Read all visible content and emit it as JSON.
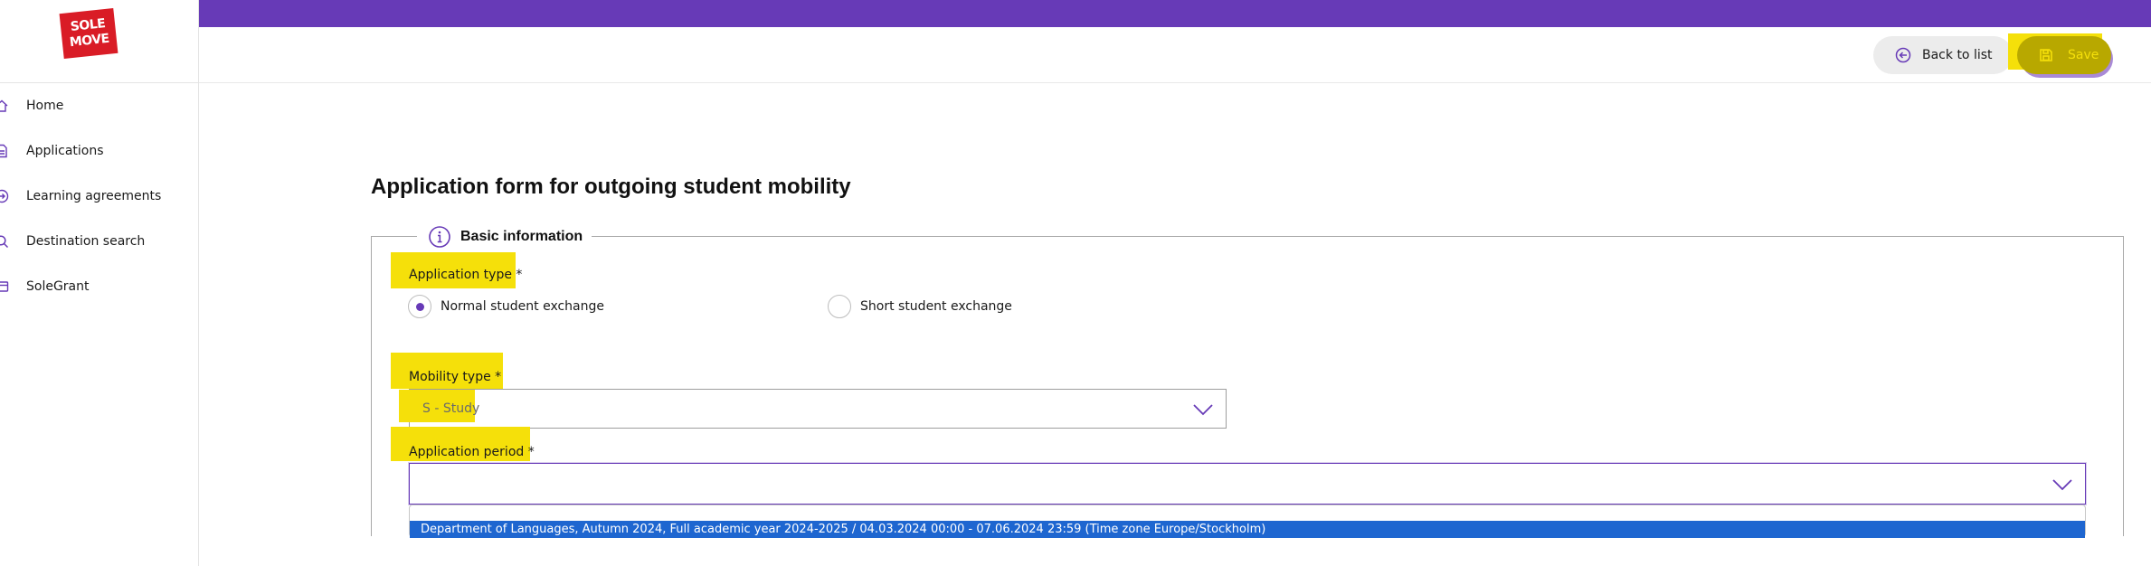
{
  "logo": {
    "text_line1": "SOLE",
    "text_line2": "MOVE"
  },
  "sidebar": {
    "items": [
      {
        "label": "Home",
        "icon": "home-icon"
      },
      {
        "label": "Applications",
        "icon": "document-icon"
      },
      {
        "label": "Learning agreements",
        "icon": "arrow-right-circle-icon"
      },
      {
        "label": "Destination search",
        "icon": "search-icon"
      },
      {
        "label": "SoleGrant",
        "icon": "card-icon"
      }
    ]
  },
  "toolbar": {
    "back_label": "Back to list",
    "save_label": "Save"
  },
  "page": {
    "title": "Application form for outgoing student mobility"
  },
  "basic_info": {
    "legend": "Basic information",
    "application_type": {
      "label": "Application type *",
      "options": [
        {
          "label": "Normal student exchange",
          "checked": true
        },
        {
          "label": "Short student exchange",
          "checked": false
        }
      ]
    },
    "mobility_type": {
      "label": "Mobility type *",
      "value": "S - Study"
    },
    "application_period": {
      "label": "Application period *",
      "value": "",
      "dropdown_options": [
        "Department of Languages, Autumn 2024, Full academic year 2024-2025 / 04.03.2024 00:00 - 07.06.2024 23:59 (Time zone Europe/Stockholm)"
      ]
    }
  },
  "colors": {
    "brand_purple": "#673ab7",
    "logo_red": "#d91c26",
    "highlight_yellow": "#f5e00a",
    "option_blue": "#1e66d0"
  }
}
